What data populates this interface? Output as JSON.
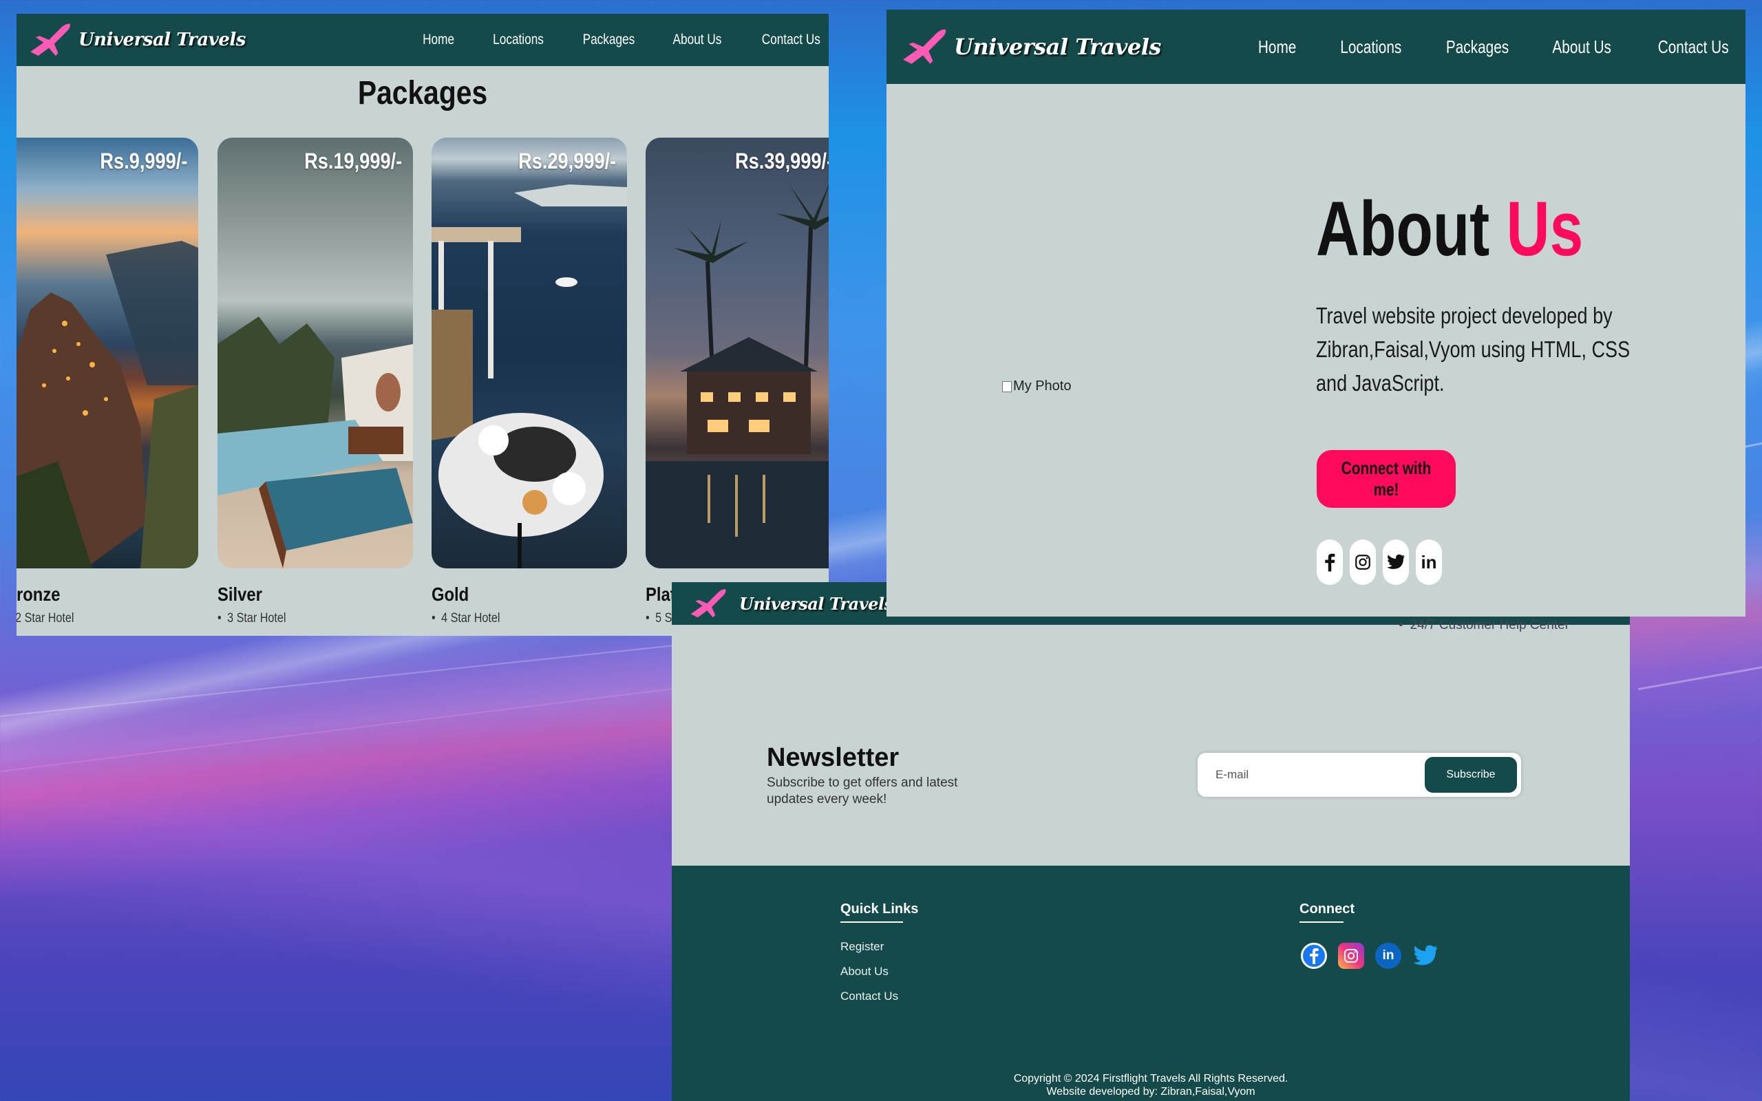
{
  "nav": {
    "brand": "Universal Travels",
    "links": [
      "Home",
      "Locations",
      "Packages",
      "About Us",
      "Contact Us"
    ]
  },
  "packages_page": {
    "title": "Packages",
    "cards": [
      {
        "price": "Rs.9,999/-",
        "name": "ronze",
        "feature": "2 Star Hotel"
      },
      {
        "price": "Rs.19,999/-",
        "name": "Silver",
        "feature": "3 Star Hotel"
      },
      {
        "price": "Rs.29,999/-",
        "name": "Gold",
        "feature": "4 Star Hotel"
      },
      {
        "price": "Rs.39,999/-",
        "name": "Plat",
        "feature": "5 S"
      }
    ]
  },
  "about_page": {
    "photo_alt": "My Photo",
    "title_main": "About",
    "title_accent": "Us",
    "description": "Travel website project developed by Zibran,Faisal,Vyom using HTML, CSS and JavaScript.",
    "connect_button": "Connect with me!",
    "socials": [
      "facebook",
      "instagram",
      "twitter",
      "linkedin"
    ]
  },
  "footer_page": {
    "help_line": "24/7 Customer Help Center",
    "newsletter": {
      "title": "Newsletter",
      "subtitle": "Subscribe to get offers and latest updates every week!",
      "input_placeholder": "E-mail",
      "button": "Subscribe"
    },
    "quick_links": {
      "heading": "Quick Links",
      "items": [
        "Register",
        "About Us",
        "Contact Us"
      ]
    },
    "connect": {
      "heading": "Connect",
      "icons": [
        "facebook-icon",
        "instagram-icon",
        "linkedin-icon",
        "twitter-icon"
      ]
    },
    "copyright": "Copyright © 2024 Firstflight Travels All Rights Reserved.",
    "credit": "Website developed by: Zibran,Faisal,Vyom"
  },
  "colors": {
    "nav": "#154a4a",
    "page_bg": "#c8d4d3",
    "accent": "#ff0a5c",
    "logo_plane": "#ff5bb5"
  }
}
